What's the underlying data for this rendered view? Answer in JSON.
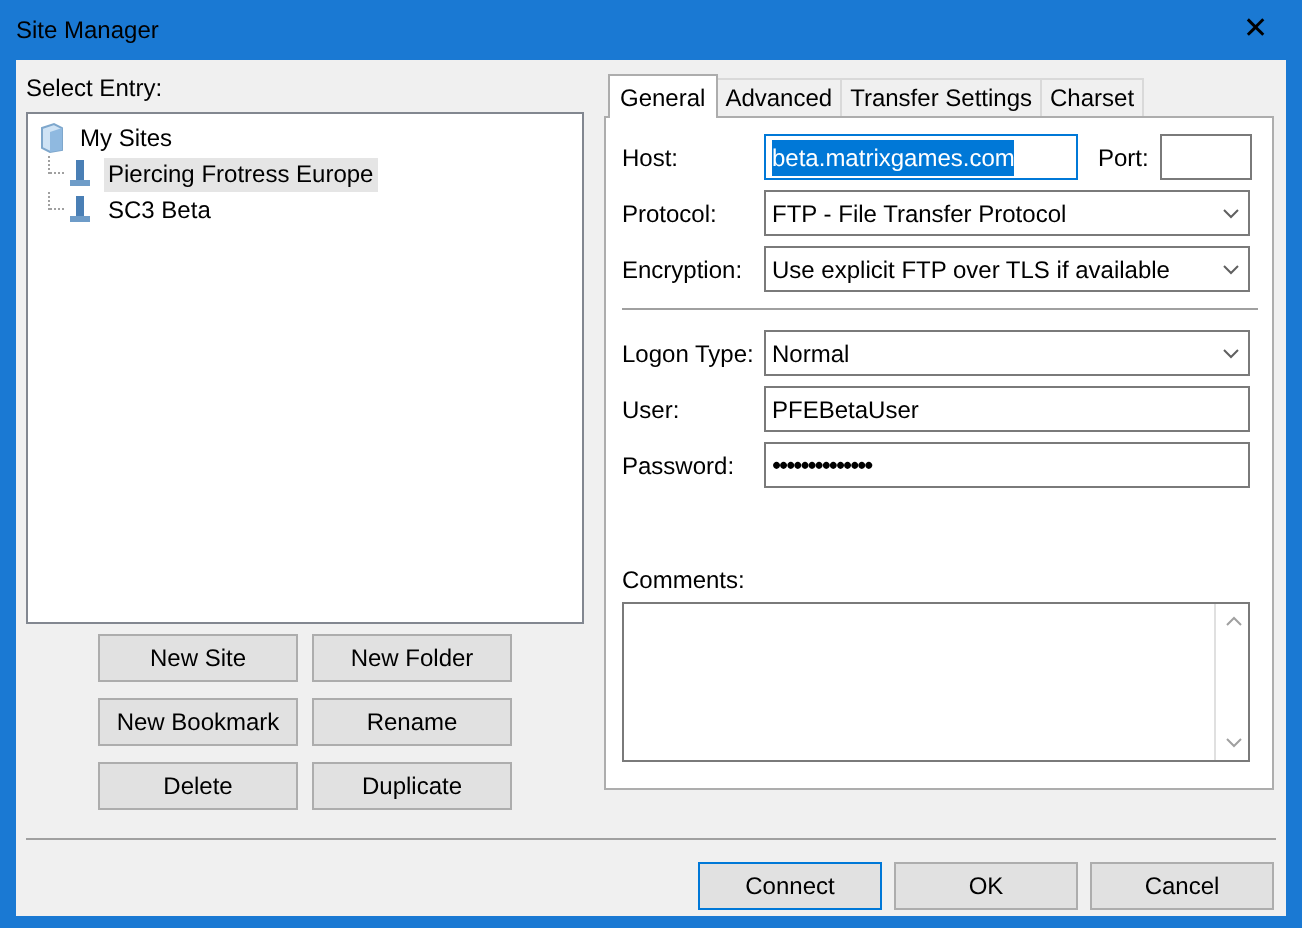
{
  "window": {
    "title": "Site Manager",
    "close": "✕"
  },
  "select_entry_label": "Select Entry:",
  "tree": [
    {
      "label": "My Sites",
      "kind": "folder",
      "selected": false,
      "children": [
        {
          "label": "Piercing Frotress Europe",
          "kind": "site",
          "selected": true
        },
        {
          "label": "SC3 Beta",
          "kind": "site",
          "selected": false
        }
      ]
    }
  ],
  "entry_buttons": [
    "New Site",
    "New Folder",
    "New Bookmark",
    "Rename",
    "Delete",
    "Duplicate"
  ],
  "tabs": [
    {
      "label": "General",
      "selected": true
    },
    {
      "label": "Advanced",
      "selected": false
    },
    {
      "label": "Transfer Settings",
      "selected": false
    },
    {
      "label": "Charset",
      "selected": false
    }
  ],
  "general": {
    "host_label": "Host:",
    "host": "beta.matrixgames.com",
    "host_text_selected": true,
    "port_label": "Port:",
    "protocol_label": "Protocol:",
    "protocol": "FTP - File Transfer Protocol",
    "encryption_label": "Encryption:",
    "encryption": "Use explicit FTP over TLS if available",
    "logon_type_label": "Logon Type:",
    "logon_type": "Normal",
    "user_label": "User:",
    "user": "PFEBetaUser",
    "password_label": "Password:",
    "password": "••••••••••••••",
    "comments_label": "Comments:"
  },
  "dialog_buttons": [
    {
      "label": "Connect",
      "default": true
    },
    {
      "label": "OK",
      "default": false
    },
    {
      "label": "Cancel",
      "default": false
    }
  ]
}
